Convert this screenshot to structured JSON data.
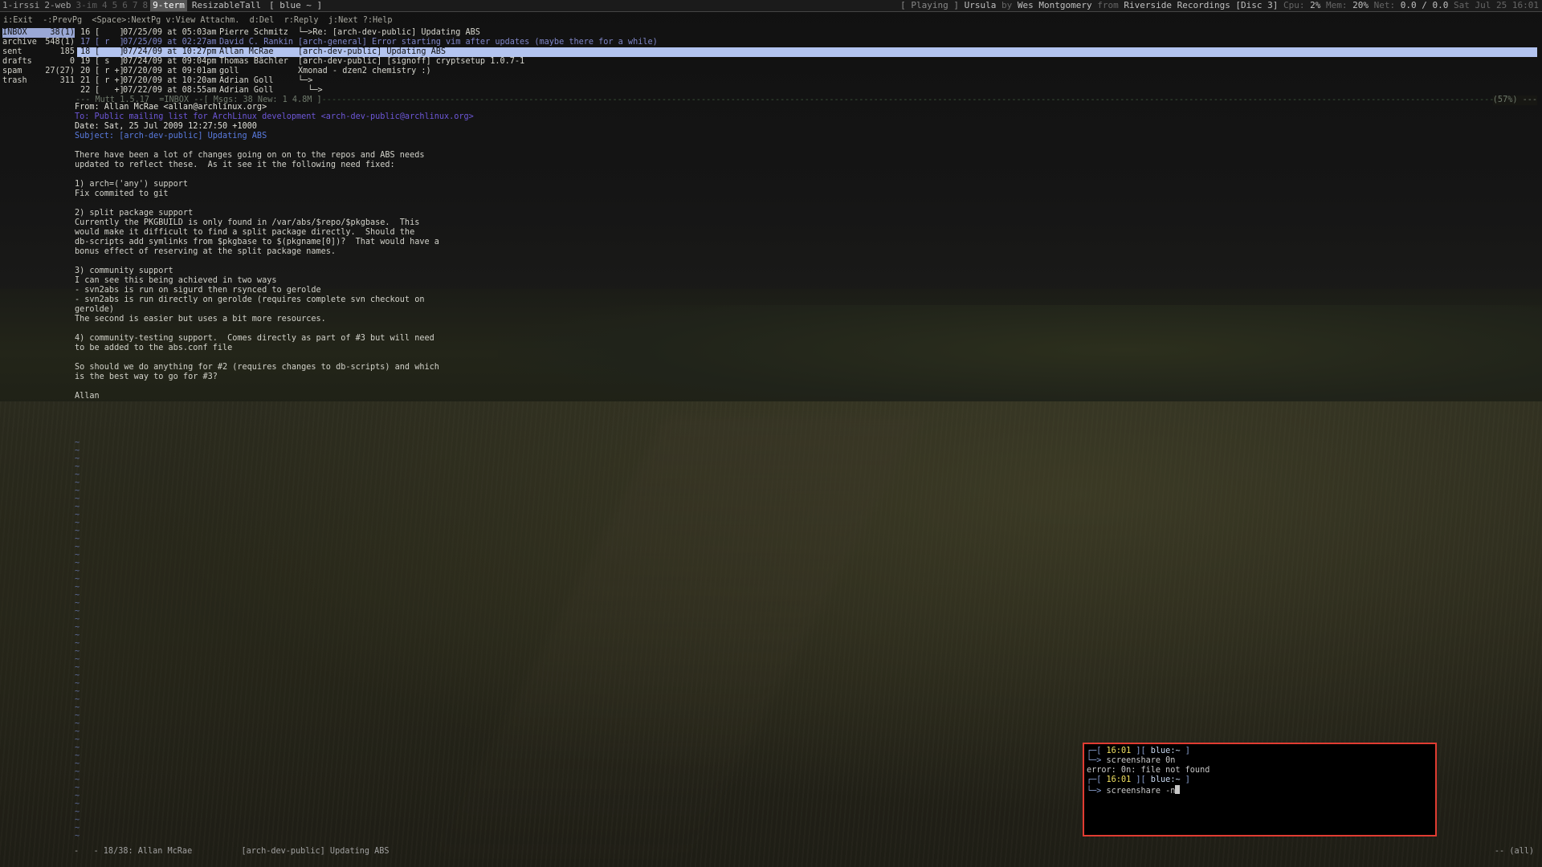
{
  "topbar": {
    "workspaces": [
      {
        "label": "1-irssi"
      },
      {
        "label": "2-web"
      },
      {
        "label": "3-im"
      },
      {
        "label": "4"
      },
      {
        "label": "5"
      },
      {
        "label": "6"
      },
      {
        "label": "7"
      },
      {
        "label": "8"
      },
      {
        "label": "9-term"
      }
    ],
    "active_workspace": "9-term",
    "layout": "ResizableTall",
    "window_title": "[ blue ~ ]",
    "now_playing": {
      "state": "[ Playing ]",
      "title": "Ursula",
      "by": "by",
      "artist": "Wes Montgomery",
      "from": "from",
      "album": "Riverside Recordings [Disc 3]"
    },
    "cpu_label": "Cpu:",
    "cpu": "2%",
    "mem_label": "Mem:",
    "mem": "20%",
    "net_label": "Net:",
    "net": "0.0 / 0.0",
    "datetime": "Sat Jul 25 16:01"
  },
  "mutt": {
    "help_line": "i:Exit  -:PrevPg  <Space>:NextPg v:View Attachm.  d:Del  r:Reply  j:Next ?:Help",
    "sidebar": [
      {
        "name": "INBOX",
        "count": "38(1)",
        "selected": true
      },
      {
        "name": "archive",
        "count": "548(1)"
      },
      {
        "name": "sent",
        "count": "185"
      },
      {
        "name": "drafts",
        "count": "0"
      },
      {
        "name": "spam",
        "count": "27(27)"
      },
      {
        "name": "trash",
        "count": "311"
      }
    ],
    "index": [
      {
        "num": "16",
        "flags": "[    ]",
        "date": "07/25/09 at 05:03am",
        "author": "Pierre Schmitz",
        "subject": "└─>Re: [arch-dev-public] Updating ABS"
      },
      {
        "num": "17",
        "flags": "[ r  ]",
        "date": "07/25/09 at 02:27am",
        "author": "David C. Rankin",
        "subject": "[arch-general] Error starting vim after updates (maybe there for a while)",
        "flagged": true
      },
      {
        "num": "18",
        "flags": "[    ]",
        "date": "07/24/09 at 10:27pm",
        "author": "Allan McRae",
        "subject": "[arch-dev-public] Updating ABS",
        "current": true
      },
      {
        "num": "19",
        "flags": "[ s  ]",
        "date": "07/24/09 at 09:04pm",
        "author": "Thomas Bächler",
        "subject": "[arch-dev-public] [signoff] cryptsetup 1.0.7-1"
      },
      {
        "num": "20",
        "flags": "[ r +]",
        "date": "07/20/09 at 09:01am",
        "author": "goll",
        "subject": "Xmonad - dzen2 chemistry :)"
      },
      {
        "num": "21",
        "flags": "[ r +]",
        "date": "07/20/09 at 10:20am",
        "author": "Adrian Goll",
        "subject": "└─>"
      },
      {
        "num": "22",
        "flags": "[   +]",
        "date": "07/22/09 at 08:55am",
        "author": "Adrian Goll",
        "subject": "  └─>"
      }
    ],
    "status_line": "--- Mutt 1.5.17  =INBOX --[ Msgs: 38 New: 1 4.8M ]",
    "status_pct": "(57%) ---",
    "headers": {
      "from": "From: Allan McRae <allan@archlinux.org>",
      "to": "To: Public mailing list for ArchLinux development <arch-dev-public@archlinux.org>",
      "date": "Date: Sat, 25 Jul 2009 12:27:50 +1000",
      "subject": "Subject: [arch-dev-public] Updating ABS"
    },
    "body": [
      "There have been a lot of changes going on on to the repos and ABS needs",
      "updated to reflect these.  As it see it the following need fixed:",
      "",
      "1) arch=('any') support",
      "Fix commited to git",
      "",
      "2) split package support",
      "Currently the PKGBUILD is only found in /var/abs/$repo/$pkgbase.  This",
      "would make it difficult to find a split package directly.  Should the",
      "db-scripts add symlinks from $pkgbase to $(pkgname[0])?  That would have a",
      "bonus effect of reserving at the split package names.",
      "",
      "3) community support",
      "I can see this being achieved in two ways",
      "- svn2abs is run on sigurd then rsynced to gerolde",
      "- svn2abs is run directly on gerolde (requires complete svn checkout on",
      "gerolde)",
      "The second is easier but uses a bit more resources.",
      "",
      "4) community-testing support.  Comes directly as part of #3 but will need",
      "to be added to the abs.conf file",
      "",
      "So should we do anything for #2 (requires changes to db-scripts) and which",
      "is the best way to go for #3?",
      "",
      "Allan"
    ],
    "tilde": "~",
    "pager_status_left": "-   - 18/38: Allan McRae          [arch-dev-public] Updating ABS",
    "pager_status_right": "-- (all)"
  },
  "float_term": {
    "prompt_open": "┌─[",
    "time1": "16:01",
    "mid": "][",
    "host": "blue:~",
    "close": "]",
    "arrow": "└─>",
    "cmd1": "screenshare 0n",
    "error": "error: 0n: file not found",
    "time2": "16:01",
    "cmd2": "screenshare -n"
  }
}
